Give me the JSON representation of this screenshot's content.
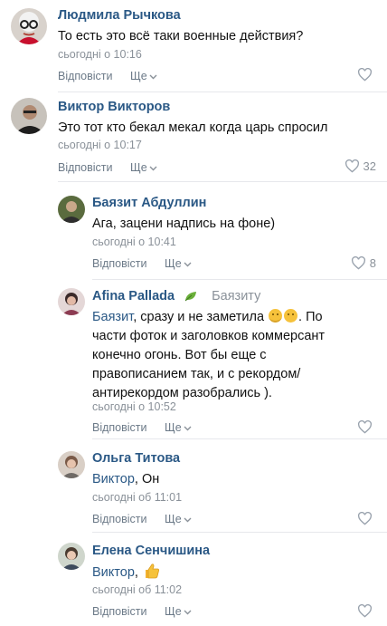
{
  "comments": [
    {
      "author": "Людмила Рычкова",
      "text": "То есть это всё таки военные действия?",
      "time": "сьогодні о 10:16",
      "reply_label": "Відповісти",
      "more_label": "Ще",
      "likes": "",
      "avatar_icon": "avatar-lyudmila"
    },
    {
      "author": "Виктор Викторов",
      "text": "Это тот кто бекал мекал когда царь спросил",
      "time": "сьогодні о 10:17",
      "reply_label": "Відповісти",
      "more_label": "Ще",
      "likes": "32",
      "avatar_icon": "avatar-viktor"
    },
    {
      "author": "Баязит Абдуллин",
      "text": "Ага, зацени надпись на фоне)",
      "time": "сьогодні о 10:41",
      "reply_label": "Відповісти",
      "more_label": "Ще",
      "likes": "8",
      "avatar_icon": "avatar-bayazit"
    },
    {
      "author": "Afina Pallada",
      "reply_to": "Баязиту",
      "mention": "Баязит",
      "text_line1": ", сразу и не заметила",
      "text_line1b": ". По",
      "text_line2": "части фоток и заголовков коммерсант",
      "text_line3": "конечно огонь. Вот бы еще с",
      "text_line4": "правописанием так, и с рекордом/",
      "text_line5": "антирекордом разобрались ).",
      "time": "сьогодні о 10:52",
      "reply_label": "Відповісти",
      "more_label": "Ще",
      "likes": "",
      "avatar_icon": "avatar-afina"
    },
    {
      "author": "Ольга Титова",
      "mention": "Виктор",
      "text": ", Он",
      "time": "сьогодні об 11:01",
      "reply_label": "Відповісти",
      "more_label": "Ще",
      "likes": "",
      "avatar_icon": "avatar-olga"
    },
    {
      "author": "Елена Сенчишина",
      "mention": "Виктор",
      "text": ",",
      "time": "сьогодні об 11:02",
      "reply_label": "Відповісти",
      "more_label": "Ще",
      "likes": "",
      "avatar_icon": "avatar-elena"
    }
  ],
  "colors": {
    "link": "#2a5885",
    "meta": "#8a9199",
    "divider": "#e7e8ec"
  }
}
